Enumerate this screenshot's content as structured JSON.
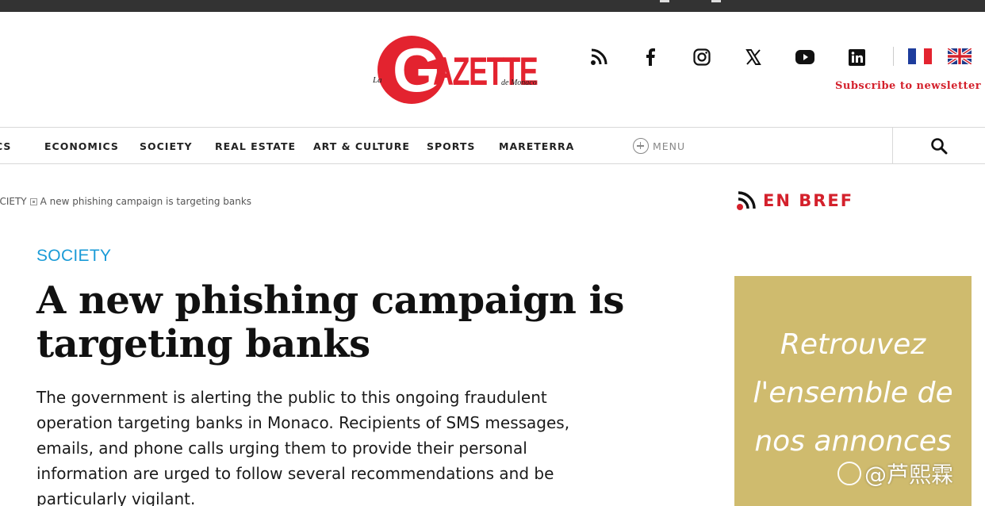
{
  "header": {
    "logo": {
      "prefix": "La",
      "letter": "G",
      "word": "AZETTE",
      "suffix": "de Monaco"
    },
    "social_icons": [
      "rss-icon",
      "facebook-icon",
      "instagram-icon",
      "x-icon",
      "youtube-icon",
      "linkedin-icon"
    ],
    "languages": [
      "flag-fr-icon",
      "flag-uk-icon"
    ],
    "subscribe_label": "Subscribe to newsletter"
  },
  "nav": {
    "items": [
      {
        "label": "CS"
      },
      {
        "label": "ECONOMICS"
      },
      {
        "label": "SOCIETY"
      },
      {
        "label": "REAL ESTATE"
      },
      {
        "label": "ART & CULTURE"
      },
      {
        "label": "SPORTS"
      },
      {
        "label": "MARETERRA"
      }
    ],
    "menu_label": "MENU"
  },
  "breadcrumb": {
    "section": "OCIETY",
    "current": "A new phishing campaign is targeting banks"
  },
  "article": {
    "category": "SOCIETY",
    "headline": "A new phishing campaign is targeting banks",
    "lede": "The government is alerting the public to this ongoing fraudulent operation targeting banks in Monaco. Recipients of SMS messages, emails, and phone calls urging them to provide their personal information are urged to follow several recommendations and be particularly vigilant."
  },
  "sidebar": {
    "brief_label": "EN BREF",
    "ad_text": "Retrouvez l'ensemble de nos annonces"
  },
  "watermark": {
    "text": "@芦熙霖"
  },
  "colors": {
    "brand_red": "#e3232f",
    "category_blue": "#1a9bd7",
    "ad_gold": "#cfbb6e",
    "topbar": "#333333"
  }
}
